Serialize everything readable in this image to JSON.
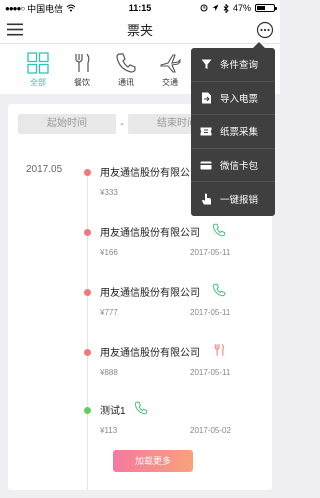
{
  "status_bar": {
    "carrier": "中国电信",
    "time": "11:15",
    "battery": "47%",
    "battery_level": 0.47
  },
  "nav": {
    "title": "票夹"
  },
  "categories": [
    {
      "label": "全部",
      "icon": "grid-icon",
      "active": true
    },
    {
      "label": "餐饮",
      "icon": "fork-knife-icon"
    },
    {
      "label": "通讯",
      "icon": "phone-icon"
    },
    {
      "label": "交通",
      "icon": "airplane-icon"
    }
  ],
  "filter": {
    "start_placeholder": "起始时间",
    "separator": "-",
    "end_placeholder": "结束时间"
  },
  "timeline": {
    "month": "2017.05",
    "entries": [
      {
        "name": "用友通信股份有限公司",
        "amount": "¥333",
        "date": "",
        "icon": "phone-icon",
        "dot_color": "#f07a7a"
      },
      {
        "name": "用友通信股份有限公司",
        "amount": "¥166",
        "date": "2017-05-11",
        "icon": "phone-icon",
        "dot_color": "#f07a7a"
      },
      {
        "name": "用友通信股份有限公司",
        "amount": "¥777",
        "date": "2017-05-11",
        "icon": "phone-icon",
        "dot_color": "#f07a7a"
      },
      {
        "name": "用友通信股份有限公司",
        "amount": "¥888",
        "date": "2017-05-11",
        "icon": "fork-knife-icon",
        "dot_color": "#f07a7a"
      },
      {
        "name": "测试1",
        "amount": "¥113",
        "date": "2017-05-02",
        "icon": "phone-icon",
        "dot_color": "#5fd05f"
      }
    ]
  },
  "load_more": "加载更多",
  "menu": {
    "items": [
      {
        "label": "条件查询",
        "icon": "filter-icon"
      },
      {
        "label": "导入电票",
        "icon": "import-doc-icon"
      },
      {
        "label": "纸票采集",
        "icon": "ticket-icon"
      },
      {
        "label": "微信卡包",
        "icon": "card-icon"
      },
      {
        "label": "一键报销",
        "icon": "tap-icon"
      }
    ]
  },
  "colors": {
    "accent": "#2cc7b8",
    "phone_icon": "#4cc27c",
    "food_icon": "#f07a7a",
    "menu_bg": "#3f3f3f"
  }
}
